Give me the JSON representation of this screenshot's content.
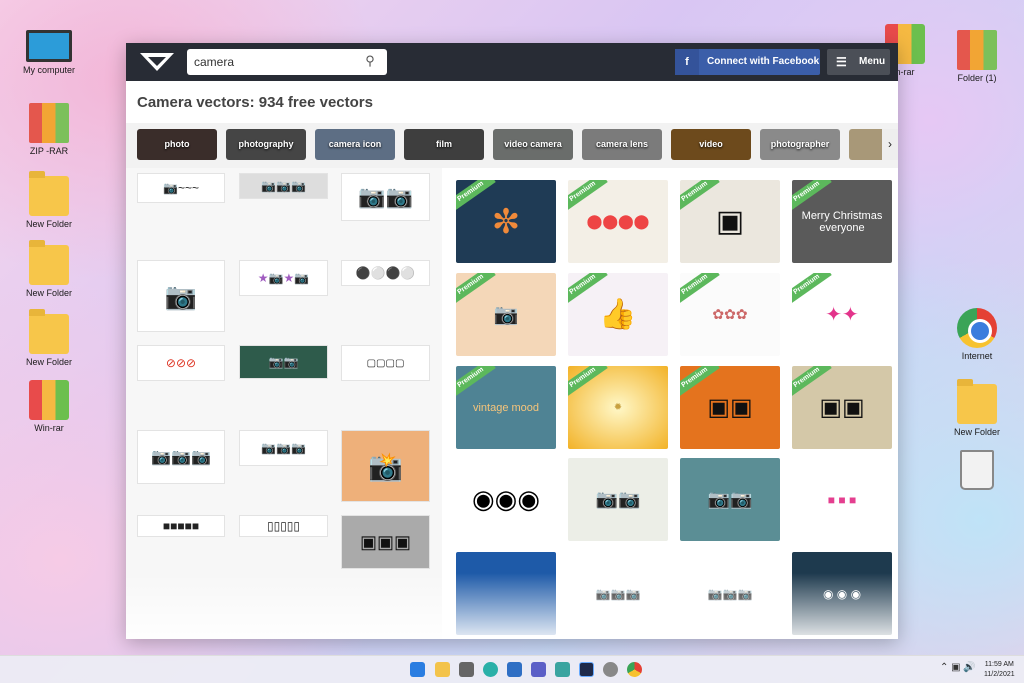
{
  "desktop": {
    "icons": [
      {
        "label": "My computer"
      },
      {
        "label": "ZIP -RAR"
      },
      {
        "label": "New Folder"
      },
      {
        "label": "New Folder"
      },
      {
        "label": "New Folder"
      },
      {
        "label": "Win-rar"
      },
      {
        "label": "n-rar"
      },
      {
        "label": "Folder (1)"
      },
      {
        "label": "Internet"
      },
      {
        "label": "New Folder"
      }
    ]
  },
  "browser": {
    "search": {
      "value": "camera"
    },
    "facebook_button": "Connect with Facebook",
    "menu_button": "Menu",
    "page_title": "Camera vectors: 934 free vectors",
    "tags": [
      "photo",
      "photography",
      "camera icon",
      "film",
      "video camera",
      "camera lens",
      "video",
      "photographer"
    ],
    "premium_label": "Premium",
    "thumb_texts": {
      "vintage": "vintage mood",
      "merry": "Merry Christmas everyone"
    }
  },
  "taskbar": {
    "time": "11:59 AM",
    "date": "11/2/2021"
  },
  "colors": {
    "topbar": "#282c35",
    "facebook": "#3b5ea9",
    "premium": "#5cb85c"
  }
}
